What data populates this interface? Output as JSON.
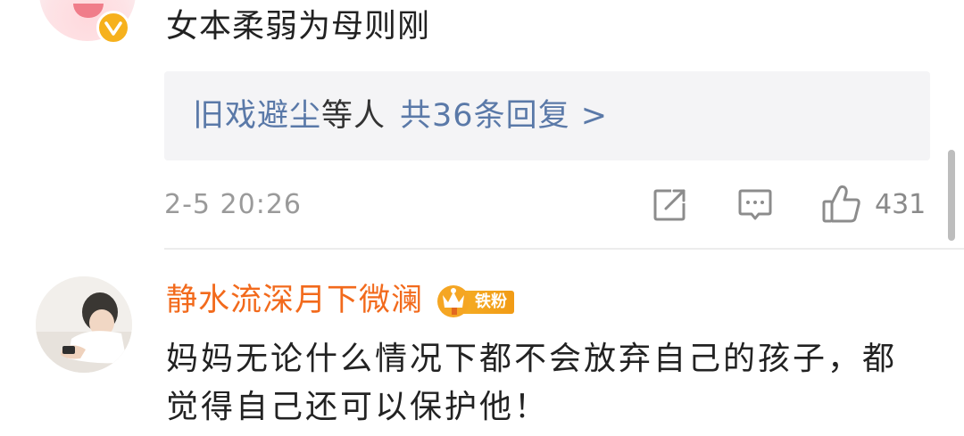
{
  "top_comment": {
    "text": "女本柔弱为母则刚",
    "reply_names": "旧戏避尘",
    "reply_mid": "等人",
    "reply_count": "共36条回复 >",
    "timestamp": "2-5 20:26",
    "like_count": "431",
    "icons": [
      "verified-icon",
      "share-icon",
      "comment-icon",
      "thumbs-up-icon"
    ]
  },
  "second_comment": {
    "username": "静水流深月下微澜",
    "badge_text": "铁粉",
    "text": "妈妈无论什么情况下都不会放弃自己的孩子，都觉得自己还可以保护他！"
  },
  "colors": {
    "link_blue": "#5a79a8",
    "username_orange": "#f26a1c",
    "badge_gold": "#f6b028",
    "meta_gray": "#9a9a9a",
    "reply_bg": "#f4f4f6"
  }
}
